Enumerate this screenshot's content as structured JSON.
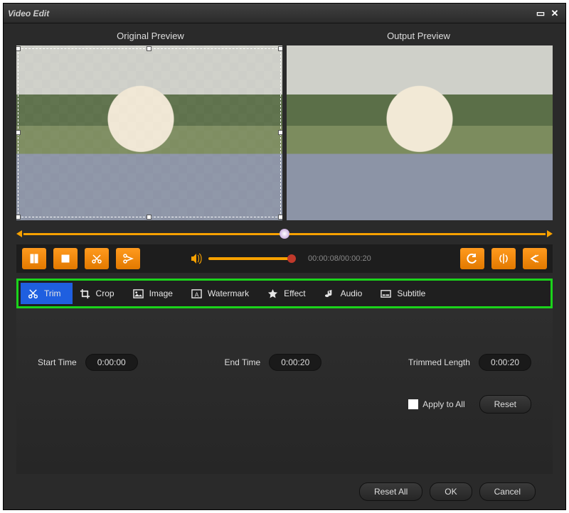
{
  "window": {
    "title": "Video Edit"
  },
  "previews": {
    "original": "Original Preview",
    "output": "Output Preview"
  },
  "playback": {
    "time_text": "00:00:08/00:00:20",
    "volume_pct": 100,
    "position_pct": 50
  },
  "tabs": [
    {
      "id": "trim",
      "label": "Trim",
      "active": true
    },
    {
      "id": "crop",
      "label": "Crop",
      "active": false
    },
    {
      "id": "image",
      "label": "Image",
      "active": false
    },
    {
      "id": "watermark",
      "label": "Watermark",
      "active": false
    },
    {
      "id": "effect",
      "label": "Effect",
      "active": false
    },
    {
      "id": "audio",
      "label": "Audio",
      "active": false
    },
    {
      "id": "subtitle",
      "label": "Subtitle",
      "active": false
    }
  ],
  "trim": {
    "start_label": "Start Time",
    "start_value": "0:00:00",
    "end_label": "End Time",
    "end_value": "0:00:20",
    "length_label": "Trimmed Length",
    "length_value": "0:00:20"
  },
  "apply_all": {
    "label": "Apply to All",
    "checked": false
  },
  "buttons": {
    "reset": "Reset",
    "reset_all": "Reset All",
    "ok": "OK",
    "cancel": "Cancel"
  }
}
